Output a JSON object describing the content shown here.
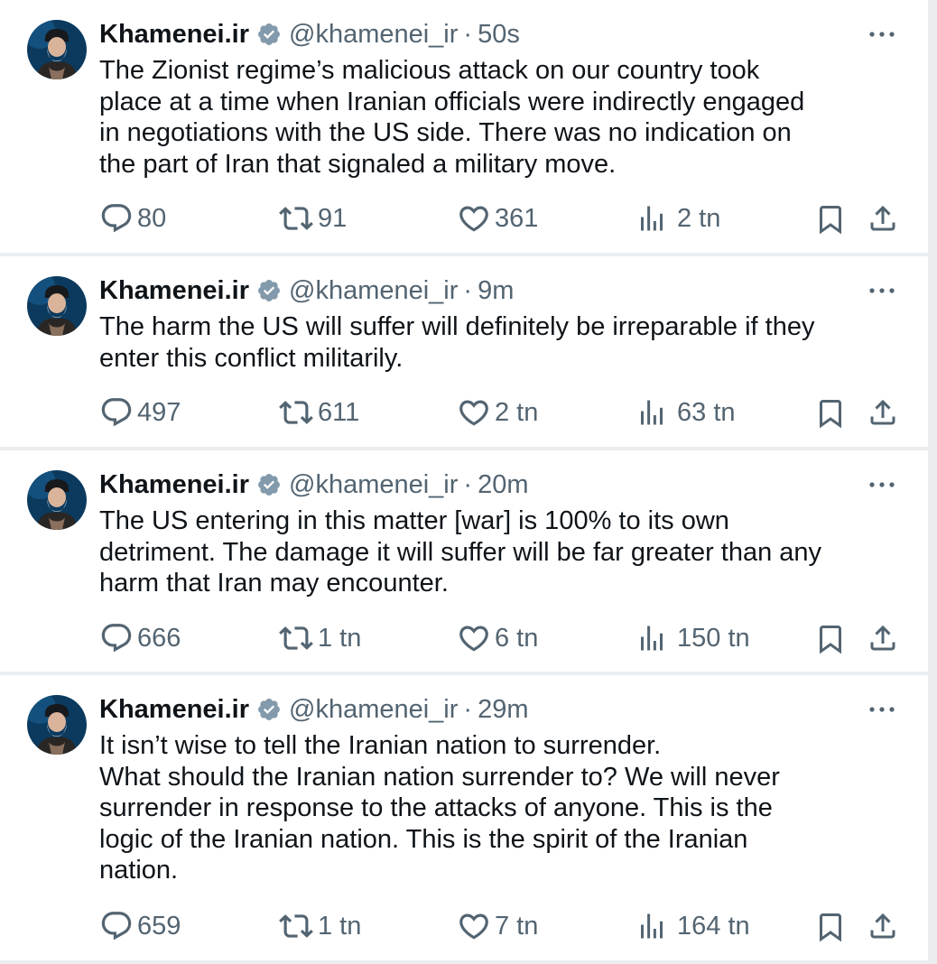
{
  "colors": {
    "text": "#0f1419",
    "secondary": "#536471",
    "verified": "#829aab",
    "separator": "#ebeef0"
  },
  "icons": [
    "reply-icon",
    "retweet-icon",
    "like-icon",
    "views-icon",
    "bookmark-icon",
    "share-icon",
    "more-icon",
    "verified-badge-icon"
  ],
  "tweets": [
    {
      "name": "Khamenei.ir",
      "handle": "@khamenei_ir",
      "separator": "·",
      "time": "50s",
      "text": "The Zionist regime’s malicious attack on our country took\nplace at a time when Iranian officials were indirectly engaged\nin negotiations with the US side. There was no indication on\nthe part of Iran that signaled a military move.",
      "replies": "80",
      "reposts": "91",
      "likes": "361",
      "views": "2 tn"
    },
    {
      "name": "Khamenei.ir",
      "handle": "@khamenei_ir",
      "separator": "·",
      "time": "9m",
      "text": "The harm the US will suffer will definitely be irreparable if they\nenter this conflict militarily.",
      "replies": "497",
      "reposts": "611",
      "likes": "2 tn",
      "views": "63 tn"
    },
    {
      "name": "Khamenei.ir",
      "handle": "@khamenei_ir",
      "separator": "·",
      "time": "20m",
      "text": "The US entering in this matter [war] is 100% to its own\ndetriment. The damage it will suffer will be far greater than any\nharm that Iran may encounter.",
      "replies": "666",
      "reposts": "1 tn",
      "likes": "6 tn",
      "views": "150 tn"
    },
    {
      "name": "Khamenei.ir",
      "handle": "@khamenei_ir",
      "separator": "·",
      "time": "29m",
      "text": "It isn’t wise to tell the Iranian nation to surrender.\nWhat should the Iranian nation surrender to? We will never\nsurrender in response to the attacks of anyone. This is the\nlogic of the Iranian nation. This is the spirit of the Iranian\nnation.",
      "replies": "659",
      "reposts": "1 tn",
      "likes": "7 tn",
      "views": "164 tn"
    }
  ]
}
